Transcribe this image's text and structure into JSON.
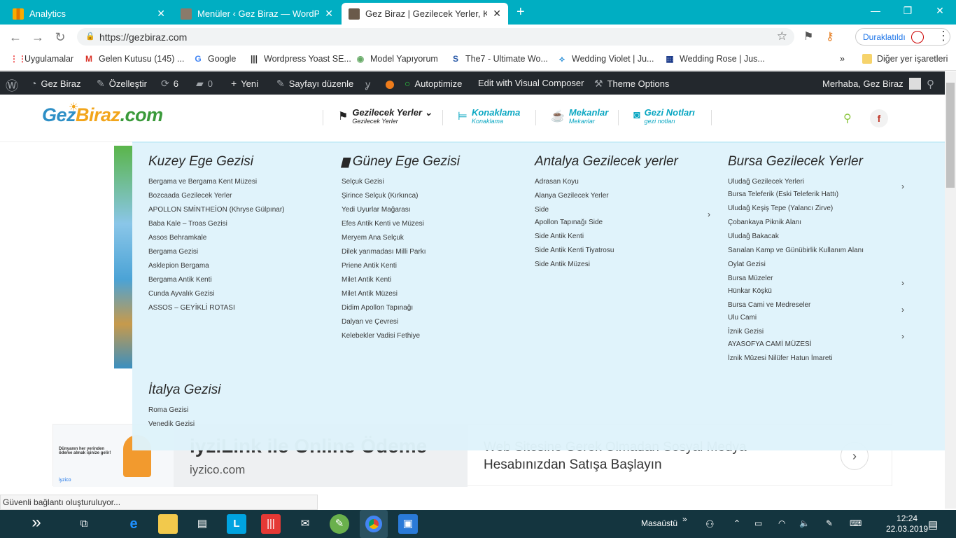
{
  "tabs": [
    {
      "title": "Analytics",
      "icon": "analytics-icon",
      "active": false
    },
    {
      "title": "Menüler ‹ Gez Biraz — WordPress",
      "icon": "site-icon",
      "active": false
    },
    {
      "title": "Gez Biraz | Gezilecek Yerler, Konaklama",
      "icon": "site-icon",
      "active": true
    }
  ],
  "toolbar": {
    "url": "https://gezbiraz.com",
    "profile_label": "Duraklatıldı"
  },
  "bookmarks": [
    {
      "label": "Uygulamalar",
      "icon": "apps-icon"
    },
    {
      "label": "Gelen Kutusu (145) ...",
      "icon": "gmail-icon"
    },
    {
      "label": "Google",
      "icon": "google-icon"
    },
    {
      "label": "Wordpress Yoast SE...",
      "icon": "barcode-icon"
    },
    {
      "label": "Model Yapıyorum",
      "icon": "model-icon"
    },
    {
      "label": "The7 - Ultimate Wo...",
      "icon": "the7-icon"
    },
    {
      "label": "Wedding Violet | Ju...",
      "icon": "wedding-icon"
    },
    {
      "label": "Wedding Rose | Jus...",
      "icon": "grid-icon"
    }
  ],
  "bookmarks_more": "»",
  "bookmarks_other": "Diğer yer işaretleri",
  "adminbar": {
    "site": "Gez Biraz",
    "customize": "Özelleştir",
    "updates": "6",
    "comments": "0",
    "new": "Yeni",
    "edit_page": "Sayfayı düzenle",
    "autoptimize": "Autoptimize",
    "visual_composer": "Edit with Visual Composer",
    "theme_options": "Theme Options",
    "greeting": "Merhaba, Gez Biraz"
  },
  "logo": {
    "part1": "Gez",
    "part2": "Biraz",
    "part3": ".com"
  },
  "mainmenu": [
    {
      "title": "Gezilecek Yerler",
      "sub": "Gezilecek Yerler",
      "icon": "signpost-icon"
    },
    {
      "title": "Konaklama",
      "sub": "Konaklama",
      "icon": "bed-icon"
    },
    {
      "title": "Mekanlar",
      "sub": "Mekanlar",
      "icon": "cup-icon"
    },
    {
      "title": "Gezi Notları",
      "sub": "gezi notları",
      "icon": "camera-icon"
    }
  ],
  "megamenu": {
    "col1": {
      "title": "Kuzey Ege Gezisi",
      "items": [
        "Bergama ve Bergama Kent Müzesi",
        "Bozcaada Gezilecek Yerler",
        "APOLLON SMİNTHEİON (Khryse Gülpınar)",
        "Baba Kale – Troas Gezisi",
        "Assos Behramkale",
        "Bergama Gezisi",
        "Asklepion Bergama",
        "Bergama Antik Kenti",
        "Cunda Ayvalık Gezisi",
        "ASSOS – GEYİKLİ ROTASI"
      ]
    },
    "col2": {
      "title": "Güney Ege Gezisi",
      "items": [
        "Selçuk Gezisi",
        "Şirince Selçuk (Kırkınca)",
        "Yedi Uyurlar Mağarası",
        "Efes Antik Kenti ve Müzesi",
        "Meryem Ana Selçuk",
        "Dilek yarımadası Milli Parkı",
        "Priene Antik Kenti",
        "Milet Antik Kenti",
        "Milet Antik Müzesi",
        "Didim Apollon Tapınağı",
        "Dalyan ve Çevresi",
        "Kelebekler Vadisi Fethiye"
      ]
    },
    "col3": {
      "title": "Antalya Gezilecek yerler",
      "items": [
        "Adrasan Koyu",
        "Alanya Gezilecek Yerler",
        "Side",
        "Apollon Tapınağı Side",
        "Side Antik Kenti",
        "Side Antik Kenti Tiyatrosu",
        "Side Antik Müzesi"
      ]
    },
    "col4": {
      "title": "Bursa Gezilecek Yerler",
      "items": [
        "Uludağ Gezilecek Yerleri",
        "Bursa Teleferik (Eski Teleferik Hattı)",
        "Uludağ Keşiş Tepe (Yalancı Zirve)",
        "Çobankaya Piknik Alanı",
        "Uludağ Bakacak",
        "Sarıalan Kamp ve Günübirlik Kullanım Alanı",
        "Oylat Gezisi",
        "Bursa Müzeler",
        "Hünkar Köşkü",
        "Bursa Cami ve Medreseler",
        "Ulu Cami",
        "İznik Gezisi",
        "AYASOFYA CAMİ MÜZESİ",
        "İznik Müzesi Nilüfer Hatun İmareti"
      ]
    },
    "col5": {
      "title": "İtalya Gezisi",
      "items": [
        "Roma Gezisi",
        "Venedik Gezisi"
      ]
    }
  },
  "ad": {
    "small_text": "Dünyanın her yerinden ödeme almak işinize gelir!",
    "small_logo": "iyzico",
    "title": "iyziLink ile Online Ödeme",
    "domain": "iyzico.com",
    "text": "Web Sitesine Gerek Olmadan Sosyal Medya Hesabınızdan Satışa Başlayın"
  },
  "status": "Güvenli bağlantı oluşturuluyor...",
  "taskbar": {
    "desktop_label": "Masaüstü",
    "time": "12:24",
    "date": "22.03.2019"
  }
}
